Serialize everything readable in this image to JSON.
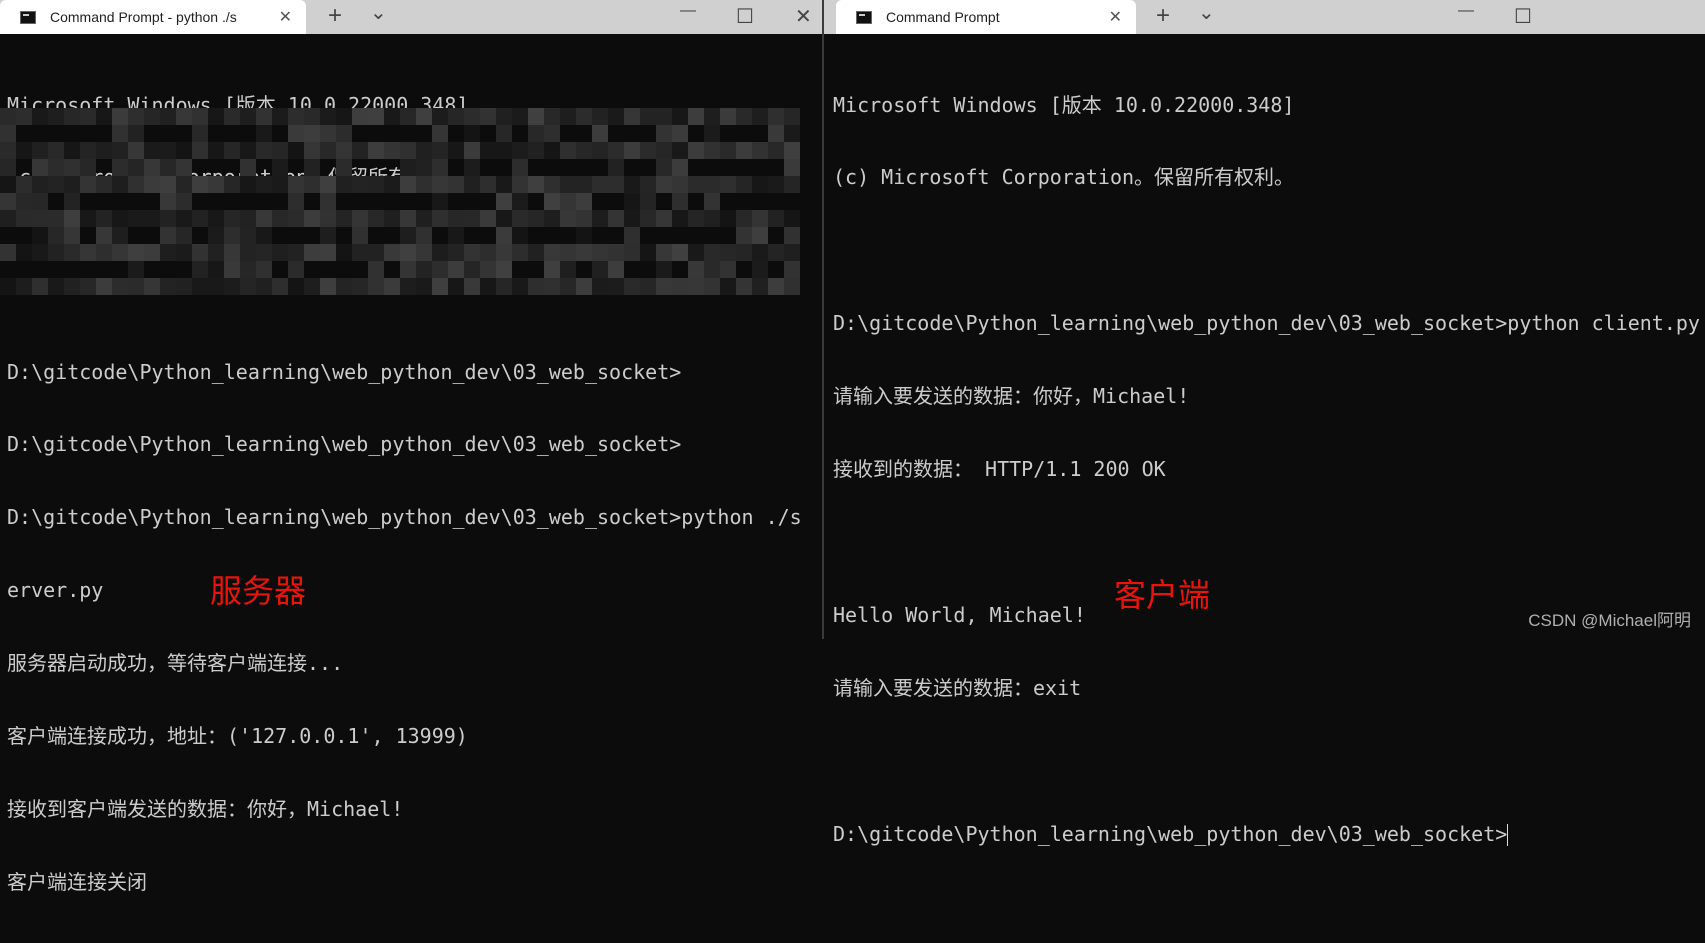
{
  "server_window": {
    "tab_title": "Command Prompt - python  ./s",
    "lines_top": [
      "Microsoft Windows [版本 10.0.22000.348]",
      "(c) Microsoft Corporation。保留所有权利。"
    ],
    "lines_bottom": [
      "D:\\gitcode\\Python_learning\\web_python_dev\\03_web_socket>",
      "D:\\gitcode\\Python_learning\\web_python_dev\\03_web_socket>",
      "D:\\gitcode\\Python_learning\\web_python_dev\\03_web_socket>python ./s",
      "erver.py",
      "服务器启动成功，等待客户端连接...",
      "客户端连接成功，地址：('127.0.0.1', 13999)",
      "接收到客户端发送的数据：你好，Michael!",
      "客户端连接关闭"
    ],
    "annotation": "服务器"
  },
  "client_window": {
    "tab_title": "Command Prompt",
    "lines": [
      "Microsoft Windows [版本 10.0.22000.348]",
      "(c) Microsoft Corporation。保留所有权利。",
      "",
      "D:\\gitcode\\Python_learning\\web_python_dev\\03_web_socket>python client.py",
      "请输入要发送的数据：你好，Michael!",
      "接收到的数据： HTTP/1.1 200 OK",
      "",
      "Hello World, Michael!",
      "请输入要发送的数据：exit",
      ""
    ],
    "prompt": "D:\\gitcode\\Python_learning\\web_python_dev\\03_web_socket>",
    "annotation": "客户端"
  },
  "controls": {
    "new_tab": "+",
    "dropdown": "⌄",
    "minimize": "—",
    "maximize": "☐",
    "close": "✕",
    "tab_close": "✕"
  },
  "watermark": "CSDN @Michael阿明",
  "colors": {
    "terminal_bg": "#0c0c0c",
    "terminal_fg": "#cccccc",
    "annotation": "#e8140c"
  }
}
